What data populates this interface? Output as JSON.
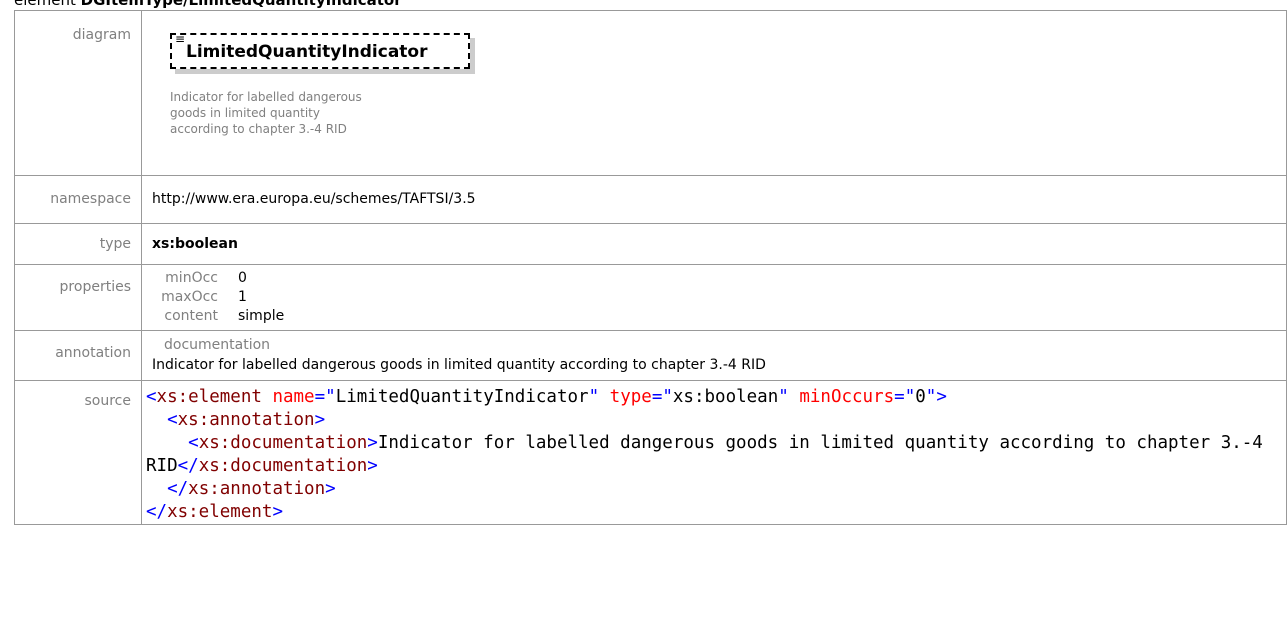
{
  "title": {
    "prefix": "element ",
    "name": "DGItemType/LimitedQuantityIndicator"
  },
  "rows": {
    "diagram": {
      "label": "diagram",
      "element_name": "LimitedQuantityIndicator",
      "element_icon": "documentation-icon",
      "documentation": "Indicator for labelled dangerous\ngoods in limited quantity\naccording to chapter 3.-4 RID"
    },
    "namespace": {
      "label": "namespace",
      "value": "http://www.era.europa.eu/schemes/TAFTSI/3.5"
    },
    "type": {
      "label": "type",
      "value": "xs:boolean"
    },
    "properties": {
      "label": "properties",
      "items": [
        {
          "key": "minOcc",
          "value": "0"
        },
        {
          "key": "maxOcc",
          "value": "1"
        },
        {
          "key": "content",
          "value": "simple"
        }
      ]
    },
    "annotation": {
      "label": "annotation",
      "heading": "documentation",
      "text": "Indicator for labelled dangerous goods in limited quantity according to chapter 3.-4 RID"
    },
    "source": {
      "label": "source",
      "lines": {
        "l1_open": "<",
        "l1_tag": "xs:element",
        "l1_attr1": "name",
        "l1_eq1": "=\"",
        "l1_val1": "LimitedQuantityIndicator",
        "l1_q1": "\"",
        "l1_attr2": "type",
        "l1_eq2": "=\"",
        "l1_val2": "xs:boolean",
        "l1_q2": "\"",
        "l1_attr3": "minOccurs",
        "l1_eq3": "=\"",
        "l1_val3": "0",
        "l1_close": "\">",
        "l2_open": "<",
        "l2_tag": "xs:annotation",
        "l2_close": ">",
        "l3_open": "<",
        "l3_tag": "xs:documentation",
        "l3_close": ">",
        "l3_text": "Indicator for labelled dangerous goods in limited quantity according to chapter 3.-4 RID",
        "l3_end_open": "</",
        "l3_end_tag": "xs:documentation",
        "l3_end_close": ">",
        "l4_open": "</",
        "l4_tag": "xs:annotation",
        "l4_close": ">",
        "l5_open": "</",
        "l5_tag": "xs:element",
        "l5_close": ">"
      }
    }
  }
}
